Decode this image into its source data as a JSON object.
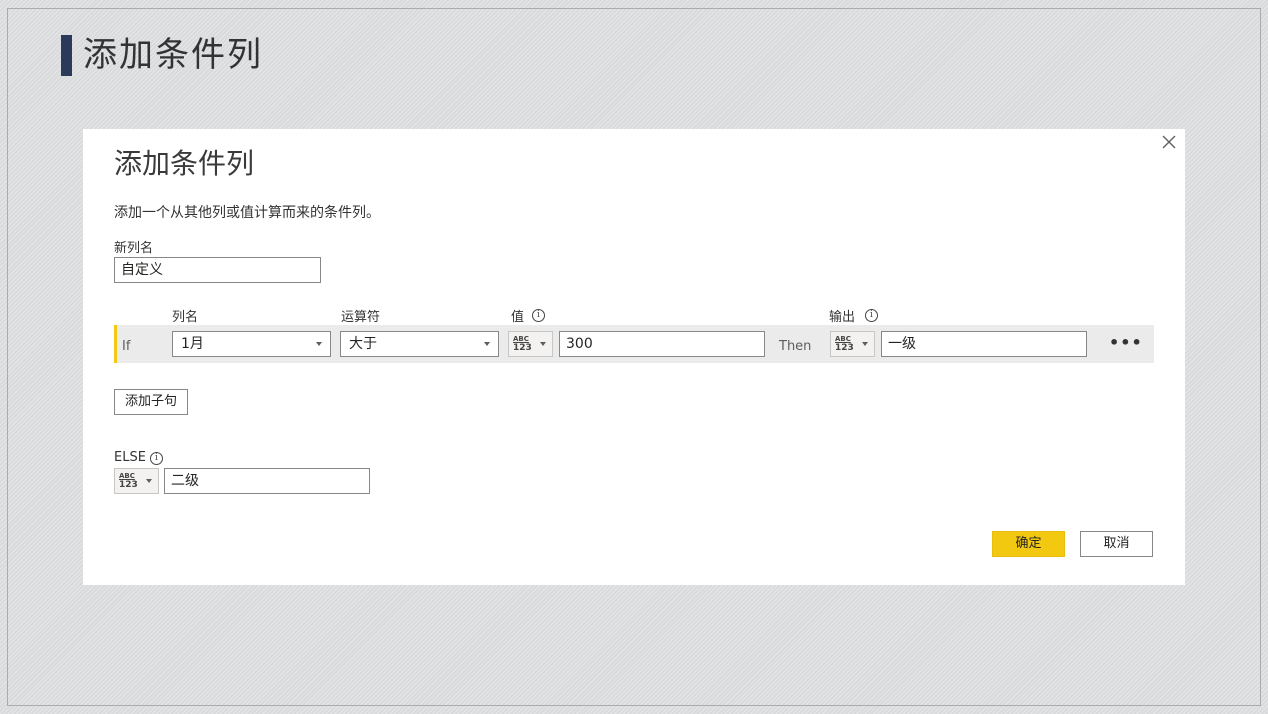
{
  "slide": {
    "title": "添加条件列"
  },
  "dialog": {
    "title": "添加条件列",
    "description": "添加一个从其他列或值计算而来的条件列。",
    "new_column": {
      "label": "新列名",
      "value": "自定义"
    },
    "headers": {
      "column_name": "列名",
      "operator": "运算符",
      "value": "值",
      "output": "输出"
    },
    "condition": {
      "keyword_if": "If",
      "column": "1月",
      "operator": "大于",
      "type_abc": "ABC",
      "type_num": "123",
      "value": "300",
      "keyword_then": "Then",
      "output": "一级",
      "more": "•••"
    },
    "add_clause_label": "添加子句",
    "else": {
      "label": "ELSE",
      "value": "二级"
    },
    "ok_label": "确定",
    "cancel_label": "取消"
  },
  "colors": {
    "accent": "#f2c811",
    "title_bar": "#2b3a5a"
  }
}
